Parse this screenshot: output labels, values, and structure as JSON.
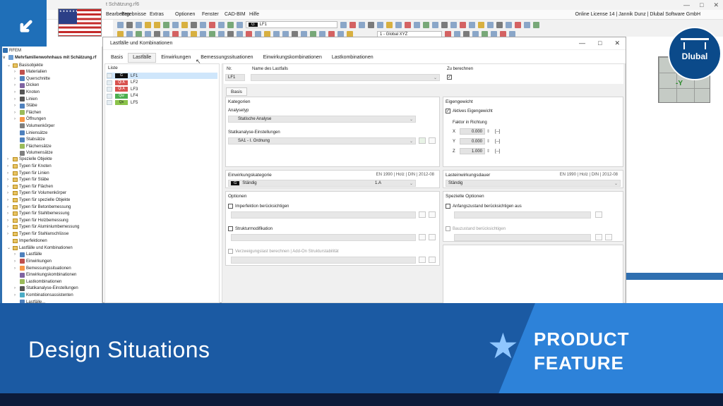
{
  "window": {
    "file_title": "t Schätzung.rf6",
    "controls": [
      "—",
      "□",
      "✕"
    ]
  },
  "menu": [
    "Bearbeiten",
    "Ergebnisse",
    "Extras",
    "Optionen",
    "Fenster",
    "CAD-BIM",
    "Hilfe"
  ],
  "license_text": "Online License 14 | Jannik Dunz | Dlubal Software GmbH",
  "toolbar": {
    "loadcase_badge": "G",
    "loadcase_value": "LF1",
    "coord_system": "1 - Global XYZ"
  },
  "brand": {
    "name": "Dlubal"
  },
  "cube": {
    "axis_label": "-Y"
  },
  "navigator": {
    "root": "RFEM",
    "model": "Mehrfamilienwohnhaus mit Schätzung.rf",
    "items": [
      {
        "label": "Basisobjekte",
        "level": 1,
        "exp": "v",
        "icon": "folder"
      },
      {
        "label": "Materialien",
        "level": 2,
        "exp": ">",
        "icon": "material"
      },
      {
        "label": "Querschnitte",
        "level": 2,
        "exp": ">",
        "icon": "section"
      },
      {
        "label": "Dicken",
        "level": 2,
        "exp": ">",
        "icon": "thickness"
      },
      {
        "label": "Knoten",
        "level": 2,
        "exp": ">",
        "icon": "node"
      },
      {
        "label": "Linien",
        "level": 2,
        "exp": ">",
        "icon": "line"
      },
      {
        "label": "Stäbe",
        "level": 2,
        "exp": ">",
        "icon": "member"
      },
      {
        "label": "Flächen",
        "level": 2,
        "exp": ">",
        "icon": "surface"
      },
      {
        "label": "Öffnungen",
        "level": 2,
        "exp": ">",
        "icon": "opening"
      },
      {
        "label": "Volumenkörper",
        "level": 2,
        "exp": "",
        "icon": "solid"
      },
      {
        "label": "Liniensätze",
        "level": 2,
        "exp": "",
        "icon": "lineset"
      },
      {
        "label": "Stabsätze",
        "level": 2,
        "exp": "",
        "icon": "memberset"
      },
      {
        "label": "Flächensätze",
        "level": 2,
        "exp": "",
        "icon": "surfaceset"
      },
      {
        "label": "Volumensätze",
        "level": 2,
        "exp": "",
        "icon": "solidset"
      },
      {
        "label": "Spezielle Objekte",
        "level": 1,
        "exp": ">",
        "icon": "folder"
      },
      {
        "label": "Typen für Knoten",
        "level": 1,
        "exp": ">",
        "icon": "folder"
      },
      {
        "label": "Typen für Linien",
        "level": 1,
        "exp": ">",
        "icon": "folder"
      },
      {
        "label": "Typen für Stäbe",
        "level": 1,
        "exp": ">",
        "icon": "folder"
      },
      {
        "label": "Typen für Flächen",
        "level": 1,
        "exp": ">",
        "icon": "folder"
      },
      {
        "label": "Typen für Volumenkörper",
        "level": 1,
        "exp": ">",
        "icon": "folder"
      },
      {
        "label": "Typen für spezielle Objekte",
        "level": 1,
        "exp": ">",
        "icon": "folder"
      },
      {
        "label": "Typen für Betonbemessung",
        "level": 1,
        "exp": ">",
        "icon": "folder"
      },
      {
        "label": "Typen für Stahlbemessung",
        "level": 1,
        "exp": ">",
        "icon": "folder"
      },
      {
        "label": "Typen für Holzbemessung",
        "level": 1,
        "exp": ">",
        "icon": "folder"
      },
      {
        "label": "Typen für Aluminiumbemessung",
        "level": 1,
        "exp": ">",
        "icon": "folder"
      },
      {
        "label": "Typen für Stahlanschlüsse",
        "level": 1,
        "exp": ">",
        "icon": "folder"
      },
      {
        "label": "Imperfektionen",
        "level": 1,
        "exp": "",
        "icon": "folder"
      },
      {
        "label": "Lastfälle und Kombinationen",
        "level": 1,
        "exp": "v",
        "icon": "folder"
      },
      {
        "label": "Lastfälle",
        "level": 2,
        "exp": ">",
        "icon": "loadcase"
      },
      {
        "label": "Einwirkungen",
        "level": 2,
        "exp": ">",
        "icon": "action"
      },
      {
        "label": "Bemessungssituationen",
        "level": 2,
        "exp": ">",
        "icon": "designsit"
      },
      {
        "label": "Einwirkungskombinationen",
        "level": 2,
        "exp": "",
        "icon": "actioncomb"
      },
      {
        "label": "Lastkombinationen",
        "level": 2,
        "exp": "",
        "icon": "loadcomb"
      },
      {
        "label": "Statikanalyse-Einstellungen",
        "level": 2,
        "exp": ">",
        "icon": "settings"
      },
      {
        "label": "Kombinationsassistenten",
        "level": 2,
        "exp": ">",
        "icon": "wizard"
      },
      {
        "label": "Lastfälle...",
        "level": 2,
        "exp": "",
        "icon": "loadcase"
      }
    ]
  },
  "dialog": {
    "title": "Lastfälle und Kombinationen",
    "controls": [
      "—",
      "□",
      "✕"
    ],
    "tabs": [
      "Basis",
      "Lastfälle",
      "Einwirkungen",
      "Bemessungssituationen",
      "Einwirkungskombinationen",
      "Lastkombinationen"
    ],
    "active_tab": 1,
    "list_header": "Liste",
    "list": [
      {
        "tag": "G",
        "tag_bg": "#111111",
        "tag_fg": "#ffffff",
        "label": "LF1",
        "selected": true
      },
      {
        "tag": "Qi A",
        "tag_bg": "#d9534f",
        "tag_fg": "#ffffff",
        "label": "LF2",
        "selected": false
      },
      {
        "tag": "Qi A",
        "tag_bg": "#d9534f",
        "tag_fg": "#ffffff",
        "label": "LF3",
        "selected": false
      },
      {
        "tag": "Qw",
        "tag_bg": "#4caf50",
        "tag_fg": "#ffffff",
        "label": "LF4",
        "selected": false
      },
      {
        "tag": "Qs",
        "tag_bg": "#8bc34a",
        "tag_fg": "#222222",
        "label": "LF5",
        "selected": false
      }
    ],
    "nr_label": "Nr.",
    "nr_value": "LF1",
    "name_label": "Name des Lastfalls",
    "calc_label": "Zu berechnen",
    "calc_checked": "✓",
    "inner_tab": "Basis",
    "kategorien": {
      "title": "Kategorien",
      "analysistype_label": "Analysetyp",
      "analysistype_value": "Statische Analyse",
      "settings_label": "Statikanalyse-Einstellungen",
      "settings_value": "SA1 - I. Ordnung"
    },
    "eigengewicht": {
      "title": "Eigengewicht",
      "active_label": "Aktives Eigengewicht",
      "active_checked": "✓",
      "factor_label": "Faktor in Richtung",
      "factors": [
        {
          "axis": "X",
          "value": "0.000",
          "unit": "[--]"
        },
        {
          "axis": "Y",
          "value": "0.000",
          "unit": "[--]"
        },
        {
          "axis": "Z",
          "value": "1.000",
          "unit": "[--]"
        }
      ]
    },
    "einwirkungskategorie": {
      "title": "Einwirkungskategorie",
      "norm": "EN 1990 | Holz | DIN | 2012-08",
      "badge": "G",
      "value": "Ständig",
      "code": "1.A"
    },
    "lasteinwirkungsdauer": {
      "title": "Lasteinwirkungsdauer",
      "norm": "EN 1990 | Holz | DIN | 2012-08",
      "value": "Ständig"
    },
    "optionen": {
      "title": "Optionen",
      "imperfection": "Imperfektion berücksichtigen",
      "structmod": "Strukturmodifikation",
      "buckling": "Verzweigungslast berechnen | Add-On Strukturstabilität"
    },
    "spezielle": {
      "title": "Spezielle Optionen",
      "initial_state": "Anfangszustand berücksichtigen aus",
      "construction": "Bauzustand berücksichtigen"
    }
  },
  "banner": {
    "title": "Design Situations",
    "tag_line1": "PRODUCT",
    "tag_line2": "FEATURE"
  },
  "colors": {
    "banner_blue": "#1b5aa3",
    "banner_light": "#2d82d9",
    "dlubal_blue": "#0b4a8a"
  }
}
